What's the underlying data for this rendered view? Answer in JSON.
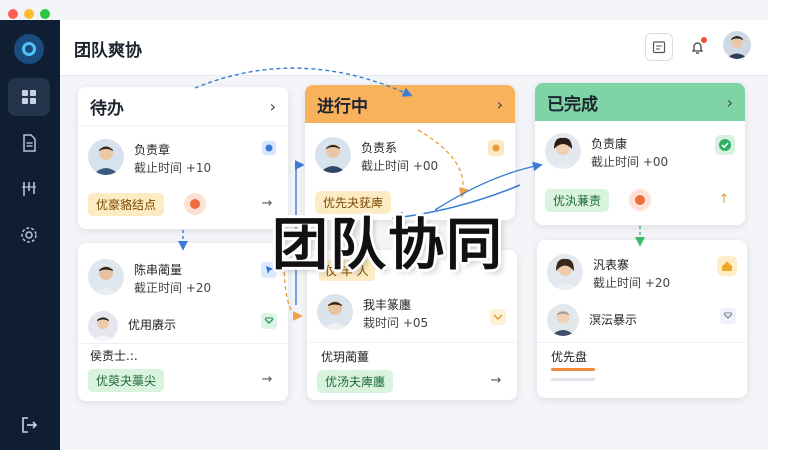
{
  "app": {
    "title": "团队爽协"
  },
  "overlay": {
    "title": "团队协同"
  },
  "colors": {
    "sidebar": "#0f1e33",
    "todo_head": "#ffffff",
    "progress_head": "#f9b25c",
    "done_head": "#7ed4a4"
  },
  "columns": {
    "todo": {
      "title": "待办",
      "chevron": "›",
      "card1": {
        "name": "负责章",
        "time": "截止时间 +10",
        "tag": "优豪貉结点",
        "arrow": "→"
      },
      "card2": {
        "name": "陈串蔺量",
        "time": "截正时间 +20",
        "sub_label": "优用赓示",
        "extra_label": "侯责士.:.",
        "tag": "优萸夬藁尖",
        "arrow": "→"
      }
    },
    "progress": {
      "title": "进行中",
      "chevron": "›",
      "card1": {
        "name": "负责系",
        "time": "截止时间 +00",
        "tag": "优先夬莸庳"
      },
      "card2": {
        "tag_hidden": "伩 丰 人",
        "name": "我丰篆廛",
        "time": "栽时问 +05",
        "sub_label": "优玥蔺薑",
        "tag": "优汤夫庳廛",
        "arrow": "→"
      }
    },
    "done": {
      "title": "已完成",
      "chevron": "›",
      "card1": {
        "name": "负责康",
        "time": "截止时间 +00",
        "tag": "优汍蒹责",
        "arrow": "↑"
      },
      "card2": {
        "name": "汎表寨",
        "time": "截止时间 +20",
        "sub_label": "溟沄暴示",
        "extra_label": "优先盘"
      }
    }
  }
}
